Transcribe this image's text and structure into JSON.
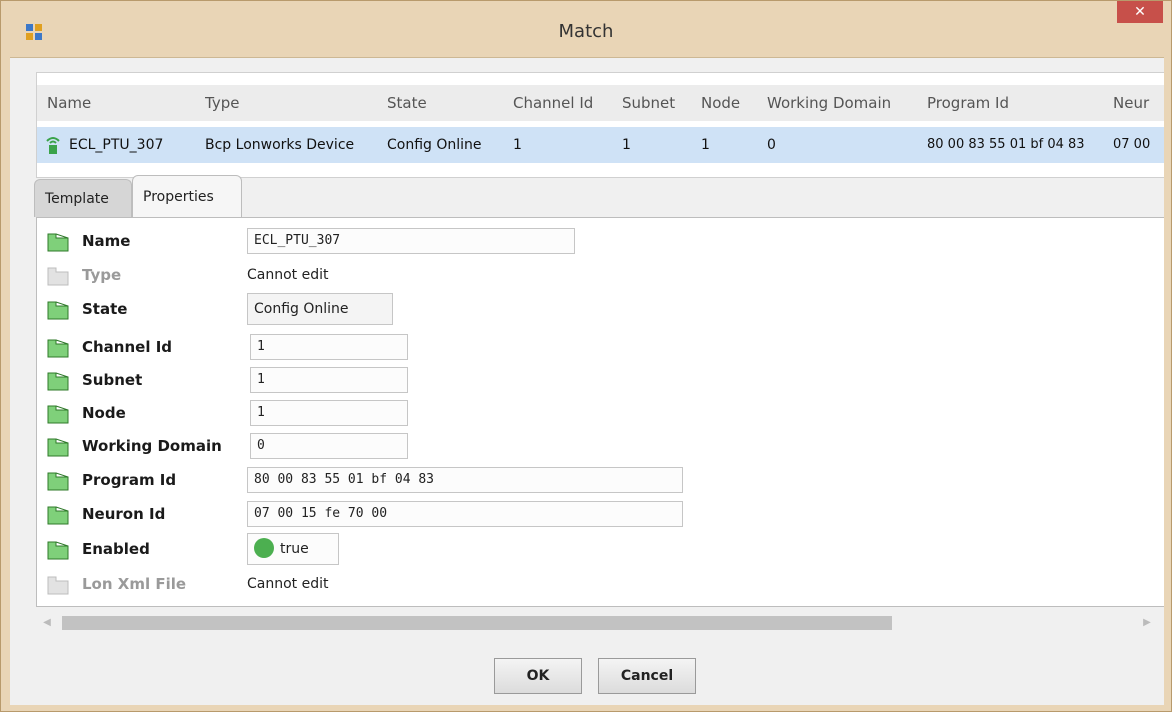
{
  "window": {
    "title": "Match",
    "close_glyph": "✕"
  },
  "table": {
    "headers": [
      "Name",
      "Type",
      "State",
      "Channel Id",
      "Subnet",
      "Node",
      "Working Domain",
      "Program Id",
      "Neur"
    ],
    "row": [
      "ECL_PTU_307",
      "Bcp Lonworks Device",
      "Config Online",
      "1",
      "1",
      "1",
      "0",
      "80 00 83 55 01 bf 04 83",
      "07 00"
    ]
  },
  "tabs": {
    "template": "Template",
    "properties": "Properties"
  },
  "properties": {
    "name": {
      "label": "Name",
      "value": "ECL_PTU_307"
    },
    "type": {
      "label": "Type",
      "value": "Cannot edit"
    },
    "state": {
      "label": "State",
      "value": "Config Online"
    },
    "channel_id": {
      "label": "Channel Id",
      "value": "1"
    },
    "subnet": {
      "label": "Subnet",
      "value": "1"
    },
    "node": {
      "label": "Node",
      "value": "1"
    },
    "working_domain": {
      "label": "Working Domain",
      "value": "0"
    },
    "program_id": {
      "label": "Program Id",
      "value": "80 00 83 55 01 bf 04 83"
    },
    "neuron_id": {
      "label": "Neuron Id",
      "value": "07 00 15 fe 70 00"
    },
    "enabled": {
      "label": "Enabled",
      "value": "true"
    },
    "lon_xml_file": {
      "label": "Lon Xml File",
      "value": "Cannot edit"
    }
  },
  "buttons": {
    "ok": "OK",
    "cancel": "Cancel"
  },
  "colors": {
    "selection": "#cfe2f6",
    "enabled_true": "#4caf50",
    "close_button": "#c7504a"
  }
}
